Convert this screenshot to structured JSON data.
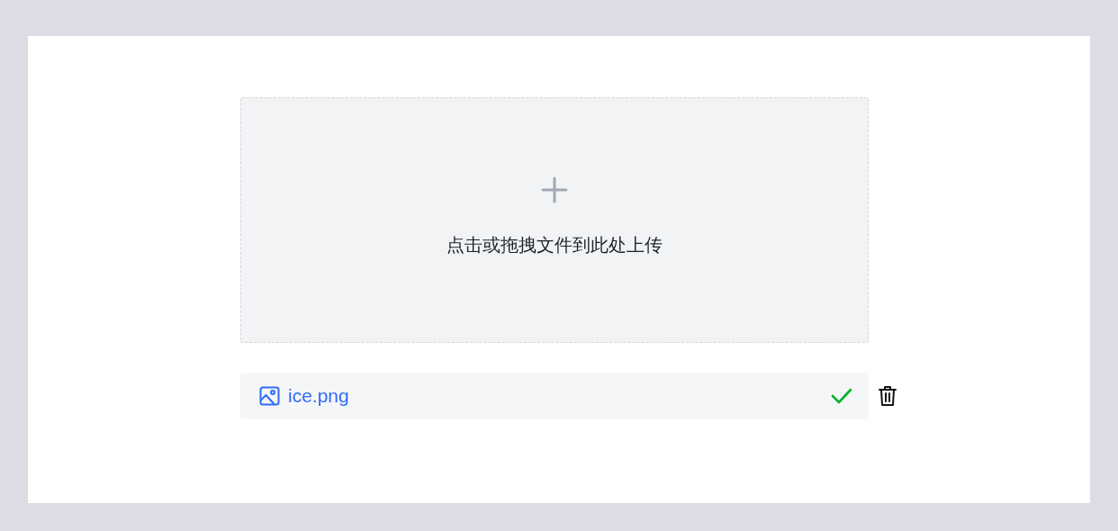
{
  "dropzone": {
    "hint": "点击或拖拽文件到此处上传"
  },
  "files": [
    {
      "name": "ice.png",
      "done": true
    }
  ]
}
